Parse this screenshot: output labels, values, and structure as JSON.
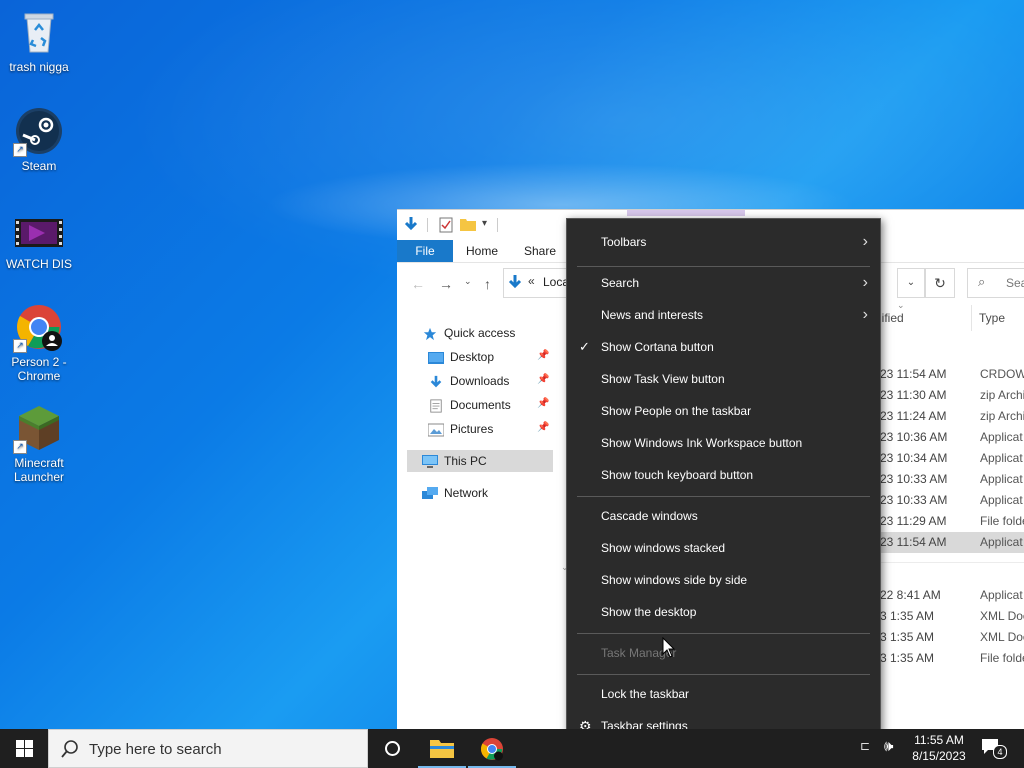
{
  "desktop": {
    "icons": [
      {
        "label": "trash nigga",
        "icon": "recycle-bin-icon"
      },
      {
        "label": "Steam",
        "icon": "steam-icon"
      },
      {
        "label": "WATCH DIS",
        "icon": "video-file-icon"
      },
      {
        "label": "Person 2 - Chrome",
        "icon": "chrome-profile-icon"
      },
      {
        "label": "Minecraft Launcher",
        "icon": "minecraft-icon"
      }
    ]
  },
  "explorer": {
    "tabs": {
      "file": "File",
      "home": "Home",
      "share": "Share"
    },
    "address_text": "Loca",
    "search_placeholder": "Sea",
    "columns": {
      "modified": "dified",
      "type": "Type"
    },
    "nav": {
      "quick_access": "Quick access",
      "desktop": "Desktop",
      "downloads": "Downloads",
      "documents": "Documents",
      "pictures": "Pictures",
      "this_pc": "This PC",
      "network": "Network"
    },
    "rows": [
      {
        "date": "23 11:54 AM",
        "type": "CRDOWN"
      },
      {
        "date": "23 11:30 AM",
        "type": "zip Archi"
      },
      {
        "date": "23 11:24 AM",
        "type": "zip Archi"
      },
      {
        "date": "23 10:36 AM",
        "type": "Applicat"
      },
      {
        "date": "23 10:34 AM",
        "type": "Applicat"
      },
      {
        "date": "23 10:33 AM",
        "type": "Applicat"
      },
      {
        "date": "23 10:33 AM",
        "type": "Applicat"
      },
      {
        "date": "23 11:29 AM",
        "type": "File folde"
      },
      {
        "date": "23 11:54 AM",
        "type": "Applicat"
      },
      {
        "date": "22 8:41 AM",
        "type": "Applicat"
      },
      {
        "date": "3 1:35 AM",
        "type": "XML Doc"
      },
      {
        "date": "3 1:35 AM",
        "type": "XML Doc"
      },
      {
        "date": "3 1:35 AM",
        "type": "File folde"
      }
    ]
  },
  "context_menu": {
    "toolbars": "Toolbars",
    "search": "Search",
    "news": "News and interests",
    "cortana": "Show Cortana button",
    "task_view": "Show Task View button",
    "people": "Show People on the taskbar",
    "ink": "Show Windows Ink Workspace button",
    "touch_kb": "Show touch keyboard button",
    "cascade": "Cascade windows",
    "stacked": "Show windows stacked",
    "side_by_side": "Show windows side by side",
    "show_desktop": "Show the desktop",
    "task_manager": "Task Manager",
    "lock": "Lock the taskbar",
    "settings": "Taskbar settings"
  },
  "taskbar": {
    "search_placeholder": "Type here to search",
    "time": "11:55 AM",
    "date": "8/15/2023",
    "notification_count": "4"
  },
  "colors": {
    "accent": "#1979ca",
    "menu_bg": "#2b2b2b",
    "taskbar_bg": "#1f1f1f"
  }
}
